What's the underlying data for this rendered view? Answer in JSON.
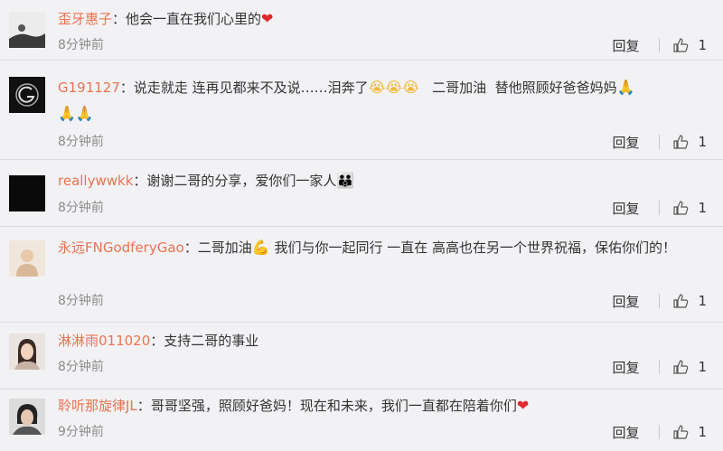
{
  "comments": [
    {
      "username": "歪牙惠子",
      "separator": "：",
      "text_parts": [
        "他会一直在我们心里的"
      ],
      "emojis": [
        "heart"
      ],
      "time": "8分钟前",
      "reply_label": "回复",
      "like_count": "1"
    },
    {
      "username": "G191127",
      "separator": "：",
      "text_parts": [
        "说走就走 连再见都来不及说……泪奔了",
        "   二哥加油  替他照顾好爸爸妈妈"
      ],
      "emojis": [
        "loudly-crying-face",
        "loudly-crying-face",
        "loudly-crying-face",
        "folded-hands",
        "folded-hands",
        "folded-hands"
      ],
      "time": "8分钟前",
      "reply_label": "回复",
      "like_count": "1"
    },
    {
      "username": "reallywwkk",
      "separator": "：",
      "text_parts": [
        "谢谢二哥的分享，爱你们一家人"
      ],
      "emojis": [
        "family"
      ],
      "time": "8分钟前",
      "reply_label": "回复",
      "like_count": "1"
    },
    {
      "username": "永远FNGodferyGao",
      "separator": "：",
      "text_parts": [
        "二哥加油",
        " 我们与你一起同行 一直在 高高也在另一个世界祝福，保佑你们的！"
      ],
      "emojis": [
        "flexed-biceps"
      ],
      "time": "8分钟前",
      "reply_label": "回复",
      "like_count": "1"
    },
    {
      "username": "淋淋雨011020",
      "separator": "：",
      "text_parts": [
        "支持二哥的事业"
      ],
      "emojis": [],
      "time": "8分钟前",
      "reply_label": "回复",
      "like_count": "1"
    },
    {
      "username": "聆听那旋律JL",
      "separator": "：",
      "text_parts": [
        "哥哥坚强，照顾好爸妈！现在和未来，我们一直都在陪着你们"
      ],
      "emojis": [
        "heart"
      ],
      "time": "9分钟前",
      "reply_label": "回复",
      "like_count": "1"
    }
  ],
  "colors": {
    "background": "#f2f2f5",
    "username": "#eb7350",
    "text": "#333333",
    "time": "#8c8c8c",
    "divider": "#dcdce0"
  }
}
